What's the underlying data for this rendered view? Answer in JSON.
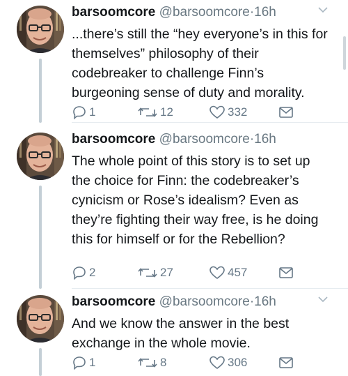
{
  "tweets": [
    {
      "name": "barsoomcore",
      "handle": "@barsoomcore",
      "dot": "·",
      "time": "16h",
      "text": "...there’s still the “hey everyone’s in this for themselves” philosophy of their codebreaker to challenge Finn’s burgeoning sense of duty and morality.",
      "replies": "1",
      "retweets": "12",
      "likes": "332"
    },
    {
      "name": "barsoomcore",
      "handle": "@barsoomcore",
      "dot": "·",
      "time": "16h",
      "text": "The whole point of this story is to set up the choice for Finn: the codebreaker’s cynicism or Rose’s idealism? Even as they’re fighting their way free, is he doing this for himself or for the Rebellion?",
      "replies": "2",
      "retweets": "27",
      "likes": "457"
    },
    {
      "name": "barsoomcore",
      "handle": "@barsoomcore",
      "dot": "·",
      "time": "16h",
      "text": "And we know the answer in the best exchange in the whole movie.",
      "replies": "1",
      "retweets": "8",
      "likes": "306"
    }
  ]
}
